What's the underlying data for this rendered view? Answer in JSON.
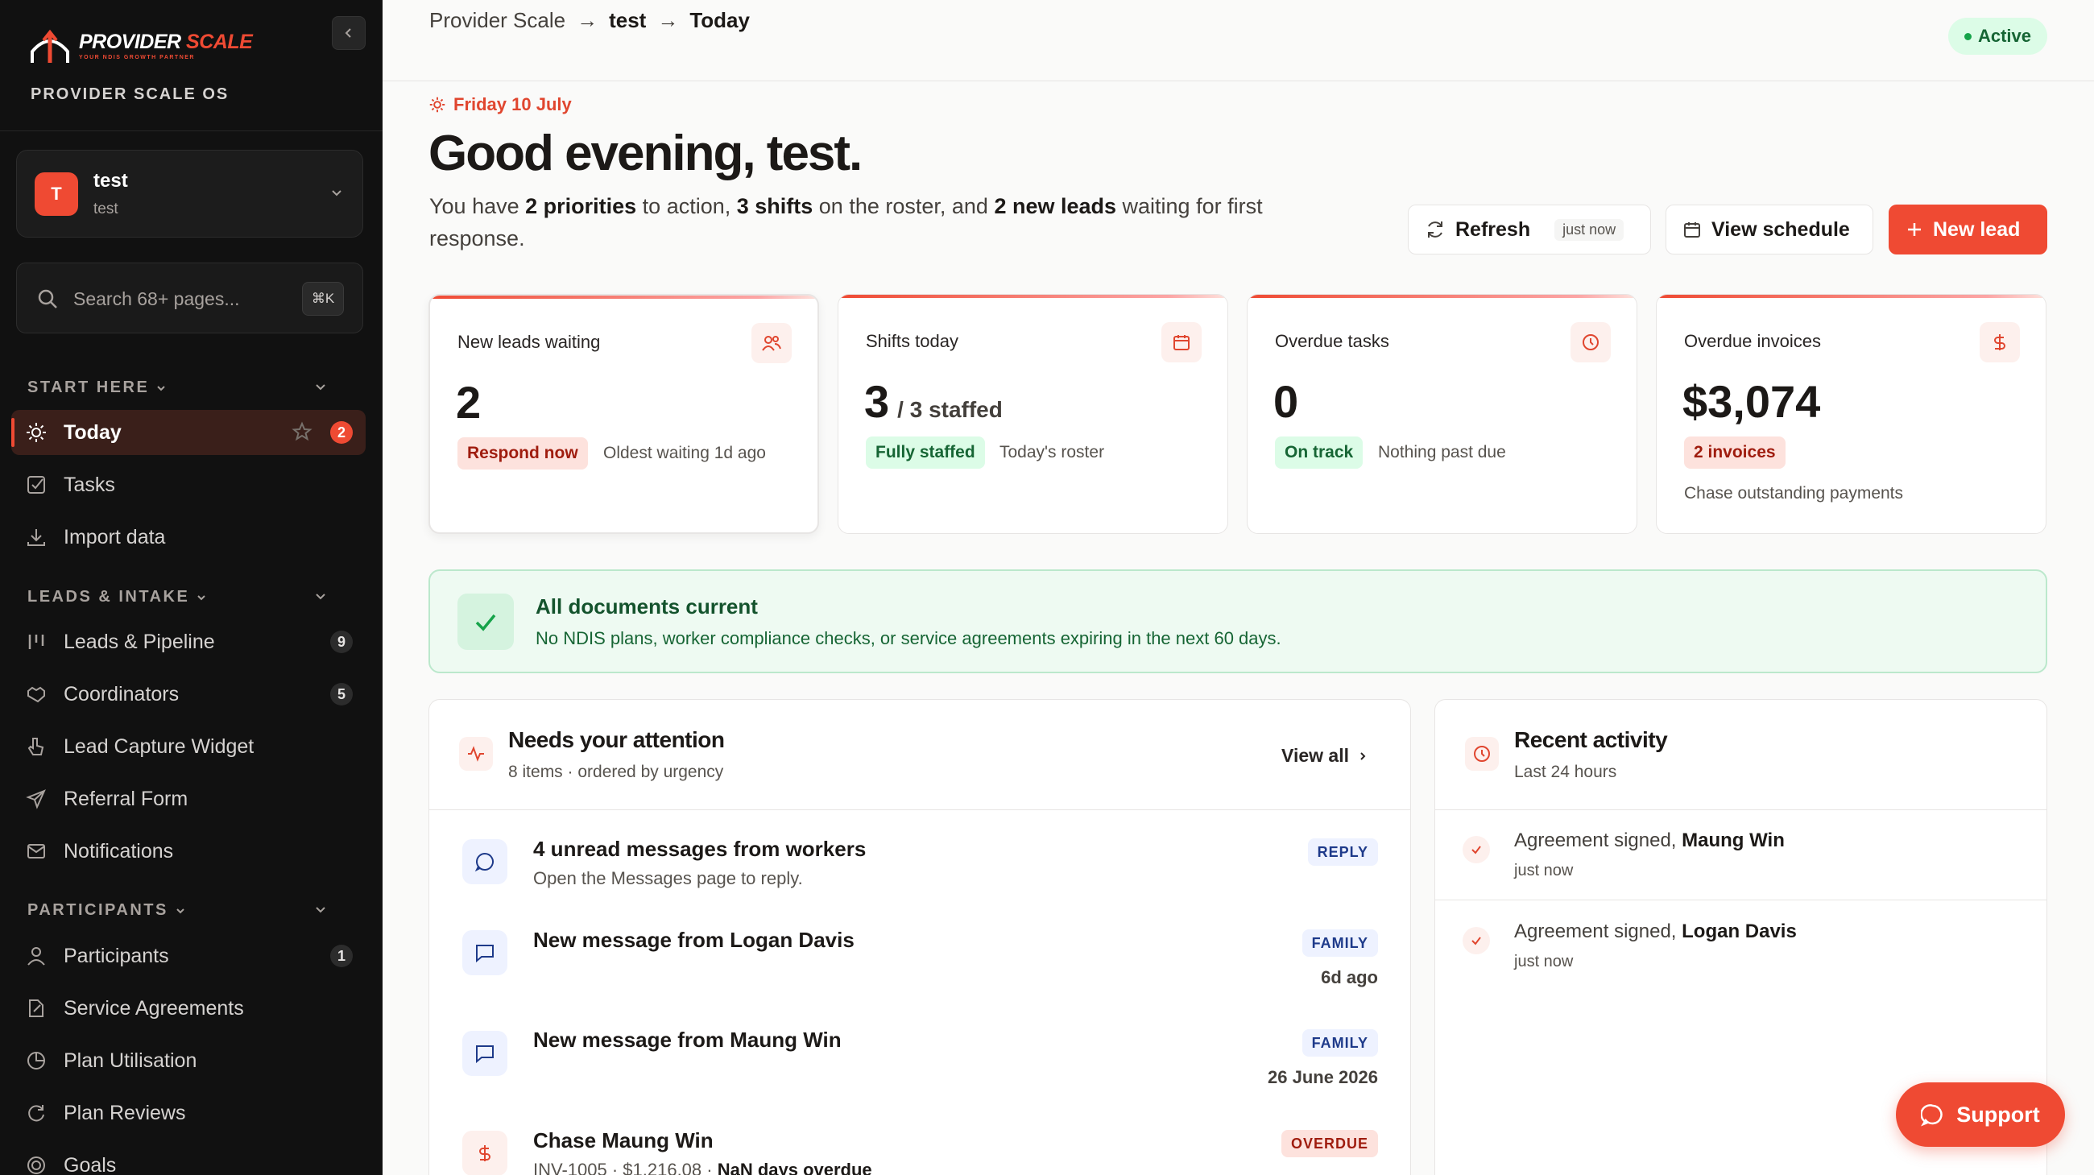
{
  "brand": {
    "name_a": "PROVIDER ",
    "name_b": "SCALE",
    "tagline": "YOUR NDIS GROWTH PARTNER",
    "os_label": "PROVIDER SCALE OS"
  },
  "org": {
    "avatar_letter": "T",
    "name": "test",
    "sub": "test"
  },
  "search": {
    "placeholder": "Search 68+ pages...",
    "shortcut": "⌘K"
  },
  "sections": {
    "start": "START HERE",
    "leads": "LEADS & INTAKE",
    "participants": "PARTICIPANTS"
  },
  "nav": {
    "today": {
      "label": "Today",
      "count": "2"
    },
    "tasks": {
      "label": "Tasks"
    },
    "import": {
      "label": "Import data"
    },
    "leads": {
      "label": "Leads & Pipeline",
      "count": "9"
    },
    "coordinators": {
      "label": "Coordinators",
      "count": "5"
    },
    "widget": {
      "label": "Lead Capture Widget"
    },
    "referral": {
      "label": "Referral Form"
    },
    "notifications": {
      "label": "Notifications"
    },
    "participants": {
      "label": "Participants",
      "count": "1"
    },
    "agreements": {
      "label": "Service Agreements"
    },
    "utilisation": {
      "label": "Plan Utilisation"
    },
    "reviews": {
      "label": "Plan Reviews"
    },
    "goals": {
      "label": "Goals"
    }
  },
  "breadcrumb": {
    "root": "Provider Scale",
    "org": "test",
    "page": "Today"
  },
  "status": "Active",
  "header": {
    "date": "Friday 10 July",
    "greeting": "Good evening, test.",
    "s1": "You have ",
    "priorities": "2 priorities",
    "s2": " to action, ",
    "shifts": "3 shifts",
    "s3": " on the roster, and ",
    "leads": "2 new leads",
    "s4": " waiting for first response."
  },
  "actions": {
    "refresh": "Refresh",
    "refresh_tag": "just now",
    "schedule": "View schedule",
    "new_lead": "New lead"
  },
  "kpis": {
    "leads": {
      "title": "New leads waiting",
      "value": "2",
      "chip": "Respond now",
      "note": "Oldest waiting 1d ago"
    },
    "shifts": {
      "title": "Shifts today",
      "value": "3",
      "sub": "/ 3 staffed",
      "chip": "Fully staffed",
      "note": "Today's roster"
    },
    "tasks": {
      "title": "Overdue tasks",
      "value": "0",
      "chip": "On track",
      "note": "Nothing past due"
    },
    "invoices": {
      "title": "Overdue invoices",
      "value": "$3,074",
      "chip": "2 invoices",
      "note": "Chase outstanding payments"
    }
  },
  "docs": {
    "title": "All documents current",
    "desc": "No NDIS plans, worker compliance checks, or service agreements expiring in the next 60 days."
  },
  "attention": {
    "title": "Needs your attention",
    "sub": "8 items · ordered by urgency",
    "view_all": "View all",
    "items": [
      {
        "title": "4 unread messages from workers",
        "desc": "Open the Messages page to reply.",
        "tag": "REPLY",
        "when": ""
      },
      {
        "title": "New message from Logan Davis",
        "desc": "",
        "tag": "FAMILY",
        "when": "6d ago"
      },
      {
        "title": "New message from Maung Win",
        "desc": "",
        "tag": "FAMILY",
        "when": "26 June 2026"
      },
      {
        "title": "Chase Maung Win",
        "desc_a": "INV-1005 · $1,216.08 · ",
        "desc_b": "NaN days overdue",
        "tag": "OVERDUE",
        "when": ""
      }
    ]
  },
  "activity": {
    "title": "Recent activity",
    "sub": "Last 24 hours",
    "items": [
      {
        "action": "Agreement signed, ",
        "who": "Maung Win",
        "time": "just now"
      },
      {
        "action": "Agreement signed, ",
        "who": "Logan Davis",
        "time": "just now"
      }
    ]
  },
  "support": "Support",
  "colors": {
    "accent": "#ef4a33",
    "sidebar": "#111111",
    "success": "#166534"
  }
}
